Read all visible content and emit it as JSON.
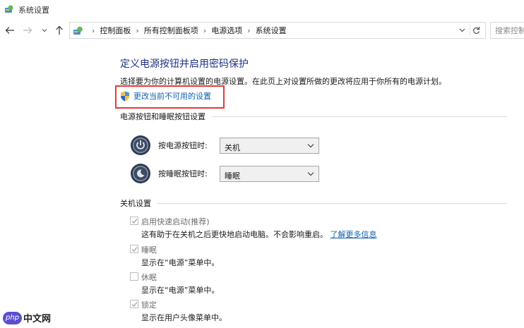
{
  "window": {
    "title": "系统设置"
  },
  "address": {
    "breadcrumbs": [
      "控制面板",
      "所有控制面板项",
      "电源选项",
      "系统设置"
    ],
    "search_placeholder": "搜索控制"
  },
  "main": {
    "title": "定义电源按钮并启用密码保护",
    "description": "选择要为你的计算机设置的电源设置。在此页上对设置所做的更改将应用于你所有的电源计划。",
    "change_link": "更改当前不可用的设置",
    "power_section": {
      "heading": "电源按钮和睡眠按钮设置",
      "rows": [
        {
          "label": "按电源按钮时:",
          "value": "关机"
        },
        {
          "label": "按睡眠按钮时:",
          "value": "睡眠"
        }
      ]
    },
    "shutdown_section": {
      "heading": "关机设置",
      "items": [
        {
          "label": "启用快速启动(推荐)",
          "checked": true,
          "desc": "这有助于在关机之后更快地启动电脑。不会影响重启。",
          "link": "了解更多信息"
        },
        {
          "label": "睡眠",
          "checked": true,
          "desc": "显示在“电源”菜单中。"
        },
        {
          "label": "休眠",
          "checked": false,
          "desc": "显示在“电源”菜单中。"
        },
        {
          "label": "锁定",
          "checked": true,
          "desc": "显示在用户头像菜单中。"
        }
      ]
    }
  },
  "watermark": {
    "badge": "php",
    "text": "中文网"
  },
  "colors": {
    "accent_link": "#1060b0",
    "title_blue": "#1e3287",
    "highlight": "#e53935"
  }
}
